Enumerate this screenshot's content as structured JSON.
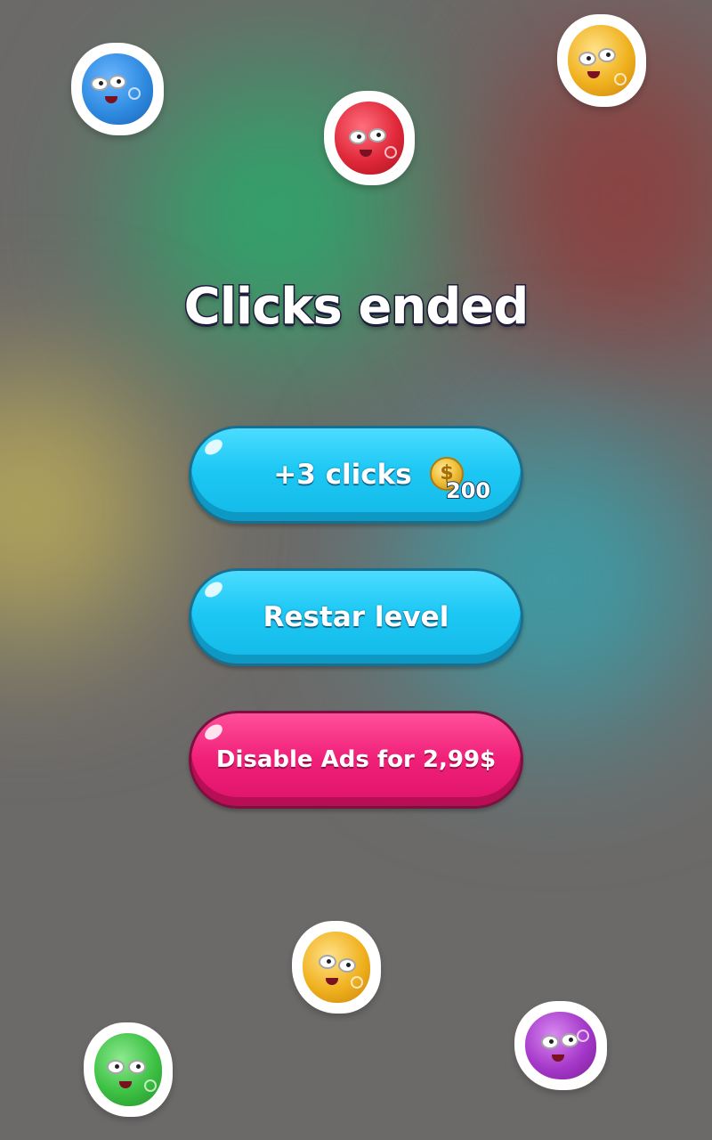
{
  "screen": {
    "title": "Clicks ended"
  },
  "buttons": {
    "extra_clicks": {
      "label": "+3 clicks",
      "price": "200",
      "currency_icon": "gold-coin-icon",
      "coin_glyph": "$"
    },
    "restart": {
      "label": "Restar level"
    },
    "disable_ads": {
      "label": "Disable Ads for 2,99$"
    }
  },
  "colors": {
    "button_blue": "#1dc8f4",
    "button_pink": "#f01f78",
    "title_outline": "#1f1d3d"
  },
  "characters": [
    {
      "name": "blue-jelly-character",
      "color": "#2f8be0"
    },
    {
      "name": "red-jelly-character",
      "color": "#e0283a"
    },
    {
      "name": "yellow-jelly-character",
      "color": "#f0b11e"
    },
    {
      "name": "yellow-jelly-character",
      "color": "#f0b11e"
    },
    {
      "name": "green-jelly-character",
      "color": "#3cc043"
    },
    {
      "name": "purple-jelly-character",
      "color": "#a538c9"
    }
  ]
}
